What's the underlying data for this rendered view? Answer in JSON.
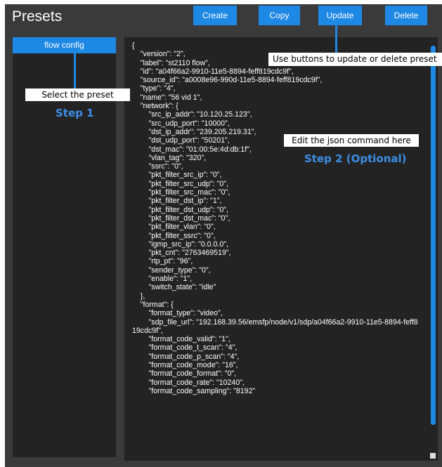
{
  "header": {
    "title": "Presets",
    "buttons": {
      "create": "Create",
      "copy": "Copy",
      "update": "Update",
      "delete": "Delete"
    }
  },
  "presets": {
    "items": [
      "flow config"
    ]
  },
  "editor": {
    "json_text": "{\n    \"version\": \"2\",\n    \"label\": \"st2110 flow\",\n    \"id\": \"a04f66a2-9910-11e5-8894-feff819cdc9f\",\n    \"source_id\": \"a0008e96-990d-11e5-8894-feff819cdc9f\",\n    \"type\": \"4\",\n    \"name\": \"56 vid 1\",\n    \"network\": {\n        \"src_ip_addr\": \"10.120.25.123\",\n        \"src_udp_port\": \"10000\",\n        \"dst_ip_addr\": \"239.205.219.31\",\n        \"dst_udp_port\": \"50201\",\n        \"dst_mac\": \"01:00:5e:4d:db:1f\",\n        \"vlan_tag\": \"320\",\n        \"ssrc\": \"0\",\n        \"pkt_filter_src_ip\": \"0\",\n        \"pkt_filter_src_udp\": \"0\",\n        \"pkt_filter_src_mac\": \"0\",\n        \"pkt_filter_dst_ip\": \"1\",\n        \"pkt_filter_dst_udp\": \"0\",\n        \"pkt_filter_dst_mac\": \"0\",\n        \"pkt_filter_vlan\": \"0\",\n        \"pkt_filter_ssrc\": \"0\",\n        \"igmp_src_ip\": \"0.0.0.0\",\n        \"pkt_cnt\": \"2763469519\",\n        \"rtp_pt\": \"96\",\n        \"sender_type\": \"0\",\n        \"enable\": \"1\",\n        \"switch_state\": \"idle\"\n    },\n    \"format\": {\n        \"format_type\": \"video\",\n        \"sdp_file_url\": \"192.168.39.56/emsfp/node/v1/sdp/a04f66a2-9910-11e5-8894-feff819cdc9f\",\n        \"format_code_valid\": \"1\",\n        \"format_code_t_scan\": \"4\",\n        \"format_code_p_scan\": \"4\",\n        \"format_code_mode\": \"16\",\n        \"format_code_format\": \"0\",\n        \"format_code_rate\": \"10240\",\n        \"format_code_sampling\": \"8192\""
  },
  "annotations": {
    "select_preset": "Select the preset",
    "step1": "Step 1",
    "buttons_hint": "Use buttons to update or delete preset",
    "edit_json": "Edit the json command here",
    "step2": "Step 2 (Optional)"
  },
  "colors": {
    "accent": "#1e88e5",
    "background": "#3a3a3a",
    "panel": "#232323",
    "step_text": "#3d8ee6"
  }
}
